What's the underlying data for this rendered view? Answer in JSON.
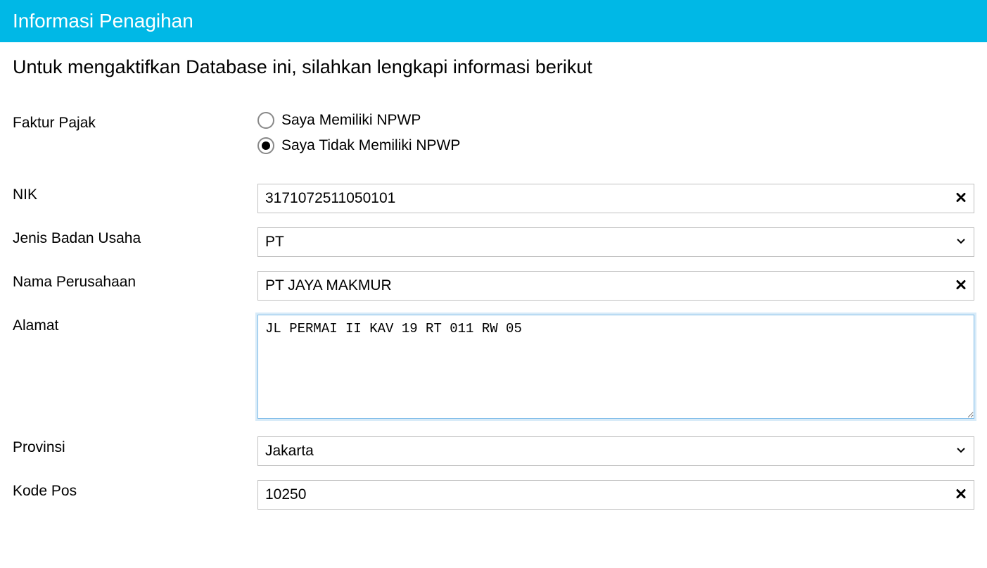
{
  "header": {
    "title": "Informasi Penagihan"
  },
  "subtitle": "Untuk mengaktifkan Database ini, silahkan lengkapi informasi berikut",
  "form": {
    "faktur_pajak": {
      "label": "Faktur Pajak",
      "option1": "Saya Memiliki NPWP",
      "option2": "Saya Tidak Memiliki NPWP"
    },
    "nik": {
      "label": "NIK",
      "value": "3171072511050101"
    },
    "jenis_badan_usaha": {
      "label": "Jenis Badan Usaha",
      "value": "PT"
    },
    "nama_perusahaan": {
      "label": "Nama Perusahaan",
      "value": "PT JAYA MAKMUR"
    },
    "alamat": {
      "label": "Alamat",
      "value": "JL PERMAI II KAV 19 RT 011 RW 05"
    },
    "provinsi": {
      "label": "Provinsi",
      "value": "Jakarta"
    },
    "kode_pos": {
      "label": "Kode Pos",
      "value": "10250"
    }
  }
}
